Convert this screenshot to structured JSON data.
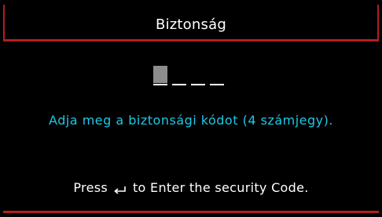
{
  "dialog": {
    "title": "Biztonság",
    "code_length": 4,
    "active_slot": 1,
    "prompt": "Adja meg a biztonsági kódot (4 számjegy).",
    "hint_before": "Press",
    "hint_icon": "enter-icon",
    "hint_after": "to Enter the security Code."
  },
  "colors": {
    "background": "#000000",
    "accent": "#b21f1f",
    "prompt": "#1ec8e6",
    "active_slot": "#8c8c8c"
  }
}
